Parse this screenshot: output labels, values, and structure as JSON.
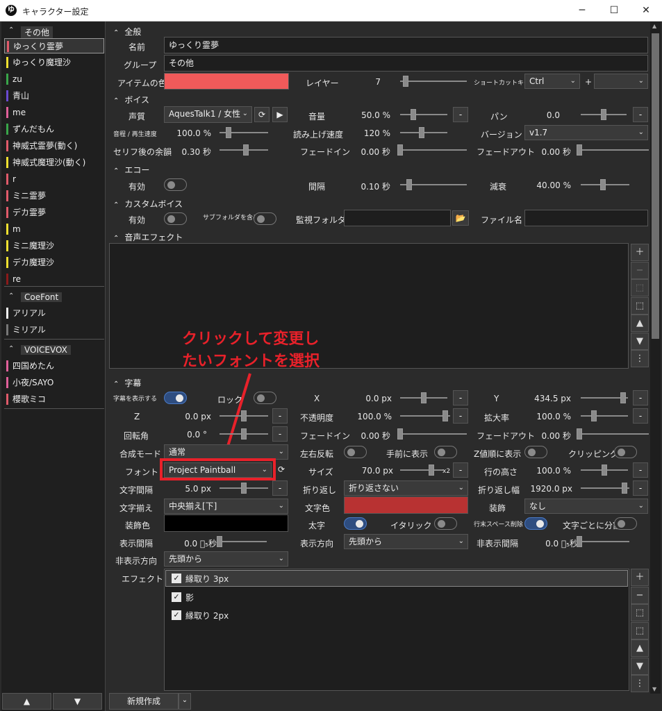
{
  "window": {
    "app_icon": "ゆ",
    "title": "キャラクター設定",
    "minimize": "─",
    "maximize": "☐",
    "close": "✕"
  },
  "sidebar": {
    "groups": [
      {
        "caret": "⌃",
        "label": "その他"
      },
      {
        "caret": "⌃",
        "label": "CoeFont"
      },
      {
        "caret": "⌃",
        "label": "VOICEVOX"
      }
    ],
    "items": [
      {
        "label": "ゆっくり霊夢",
        "color": "#e05a6a"
      },
      {
        "label": "ゆっくり魔理沙",
        "color": "#f0e030"
      },
      {
        "label": "zu",
        "color": "#39a64a"
      },
      {
        "label": "青山",
        "color": "#6a4ad0"
      },
      {
        "label": "me",
        "color": "#e0609a"
      },
      {
        "label": "ずんだもん",
        "color": "#39a64a"
      },
      {
        "label": "神威式霊夢(動く)",
        "color": "#e05a6a"
      },
      {
        "label": "神威式魔理沙(動く)",
        "color": "#f0e030"
      },
      {
        "label": "r",
        "color": "#e05a6a"
      },
      {
        "label": "ミニ霊夢",
        "color": "#e05a6a"
      },
      {
        "label": "デカ霊夢",
        "color": "#e05a6a"
      },
      {
        "label": "m",
        "color": "#f0e030"
      },
      {
        "label": "ミニ魔理沙",
        "color": "#f0e030"
      },
      {
        "label": "デカ魔理沙",
        "color": "#f0e030"
      },
      {
        "label": "re",
        "color": "#8b1a1a"
      },
      {
        "label": "アリアル",
        "color": "#f2f2f2"
      },
      {
        "label": "ミリアル",
        "color": "#777777"
      },
      {
        "label": "四国めたん",
        "color": "#e0609a"
      },
      {
        "label": "小夜/SAYO",
        "color": "#e0609a"
      },
      {
        "label": "櫻歌ミコ",
        "color": "#e05a6a"
      }
    ],
    "up_button": "▲",
    "down_button": "▼"
  },
  "general": {
    "header": "全般",
    "caret": "⌃",
    "name_label": "名前",
    "name_value": "ゆっくり霊夢",
    "group_label": "グループ",
    "group_value": "その他",
    "item_color_label": "アイテムの色",
    "item_color": "#f05a5a",
    "layer_label": "レイヤー",
    "layer_value": "7",
    "layer_level": 0.05,
    "shortcut_label": "ショートカットキー",
    "shortcut_modifier": "Ctrl",
    "shortcut_plus": "+",
    "shortcut_key": ""
  },
  "voice": {
    "header": "ボイス",
    "caret": "⌃",
    "engine_label": "声質",
    "engine_value": "AquesTalk1 / 女性",
    "refresh_icon": "⟳",
    "play_icon": "▶",
    "volume_label": "音量",
    "volume_value": "50.0 %",
    "volume_level": 0.25,
    "pan_label": "パン",
    "pan_value": "0.0",
    "pan_level": 0.5,
    "pitch_label": "音程 / 再生速度",
    "pitch_value": "100.0 %",
    "pitch_level": 0.15,
    "speed_label": "読み上げ速度",
    "speed_value": "120 %",
    "speed_level": 0.45,
    "version_label": "バージョン",
    "version_value": "v1.7",
    "after_label": "セリフ後の余韻",
    "after_value": "0.30 秒",
    "after_level": 0.55,
    "fadein_label": "フェードイン",
    "fadein_value": "0.00 秒",
    "fadein_level": 0.0,
    "fadeout_label": "フェードアウト",
    "fadeout_value": "0.00 秒",
    "fadeout_level": 0.0,
    "minus": "-"
  },
  "echo": {
    "header": "エコー",
    "caret": "⌃",
    "enabled_label": "有効",
    "interval_label": "間隔",
    "interval_value": "0.10 秒",
    "interval_level": 0.1,
    "decay_label": "減衰",
    "decay_value": "40.00 %",
    "decay_level": 0.45
  },
  "custom_voice": {
    "header": "カスタムボイス",
    "caret": "⌃",
    "enabled_label": "有効",
    "subfolder_label": "サブフォルダを含める",
    "watch_label": "監視フォルダ",
    "watch_value": "",
    "folder_icon": "📂",
    "file_label": "ファイル名",
    "file_value": ""
  },
  "sound_effect": {
    "header": "音声エフェクト",
    "caret": "⌃",
    "buttons": [
      "＋",
      "−",
      "⬚",
      "⬚",
      "▲",
      "▼",
      "⋮"
    ]
  },
  "annotation": {
    "line1": "クリックして変更し",
    "line2": "たいフォントを選択"
  },
  "subtitle": {
    "header": "字幕",
    "caret": "⌃",
    "show_label": "字幕を表示する",
    "lock_label": "ロック",
    "x_label": "X",
    "x_value": "0.0 px",
    "x_level": 0.5,
    "y_label": "Y",
    "y_value": "434.5 px",
    "y_level": 0.95,
    "z_label": "Z",
    "z_value": "0.0 px",
    "z_level": 0.5,
    "opacity_label": "不透明度",
    "opacity_value": "100.0 %",
    "opacity_level": 0.95,
    "scale_label": "拡大率",
    "scale_value": "100.0 %",
    "scale_level": 0.25,
    "rotation_label": "回転角",
    "rotation_value": "0.0 °",
    "rotation_level": 0.5,
    "fadein_label": "フェードイン",
    "fadein_value": "0.00 秒",
    "fadein_level": 0.0,
    "fadeout_label": "フェードアウト",
    "fadeout_value": "0.00 秒",
    "fadeout_level": 0.0,
    "blend_label": "合成モード",
    "blend_value": "通常",
    "flip_label": "左右反転",
    "front_label": "手前に表示",
    "zorder_label": "Z値順に表示",
    "clip_label": "クリッピング",
    "font_label": "フォント",
    "font_value": "Project Paintball",
    "size_label": "サイズ",
    "size_value": "70.0 px",
    "size_level": 0.75,
    "size_mult": "x2",
    "lineheight_label": "行の高さ",
    "lineheight_value": "100.0 %",
    "lineheight_level": 0.5,
    "spacing_label": "文字間隔",
    "spacing_value": "5.0 px",
    "spacing_level": 0.5,
    "wrap_label": "折り返し",
    "wrap_value": "折り返さない",
    "wrapwidth_label": "折り返し幅",
    "wrapwidth_value": "1920.0 px",
    "wrapwidth_level": 0.95,
    "align_label": "文字揃え",
    "align_value": "中央揃え[下]",
    "textcolor_label": "文字色",
    "text_color": "#b83232",
    "deco_label": "装飾",
    "deco_value": "なし",
    "decocolor_label": "装飾色",
    "deco_color": "#000000",
    "bold_label": "太字",
    "italic_label": "イタリック",
    "trim_label": "行末スペース削除",
    "split_label": "文字ごとに分割",
    "showint_label": "表示間隔",
    "showint_value": "0.0 ﾞ₅秒",
    "showint_level": 0.0,
    "showdir_label": "表示方向",
    "showdir_value": "先頭から",
    "hideint_label": "非表示間隔",
    "hideint_value": "0.0 ﾞ₅秒",
    "hideint_level": 0.0,
    "hidedir_label": "非表示方向",
    "hidedir_value": "先頭から",
    "effect_label": "エフェクト",
    "effects": [
      {
        "label": "縁取り 3px",
        "checked": true
      },
      {
        "label": "影",
        "checked": true
      },
      {
        "label": "縁取り 2px",
        "checked": true
      }
    ],
    "effect_buttons": [
      "＋",
      "−",
      "⬚",
      "⬚",
      "▲",
      "▼",
      "⋮"
    ],
    "check_mark": "✓",
    "minus": "-"
  },
  "footer": {
    "new_button": "新規作成",
    "dropdown_icon": "⌄"
  },
  "scrollbar": {
    "up": "▲",
    "down": "▼"
  }
}
